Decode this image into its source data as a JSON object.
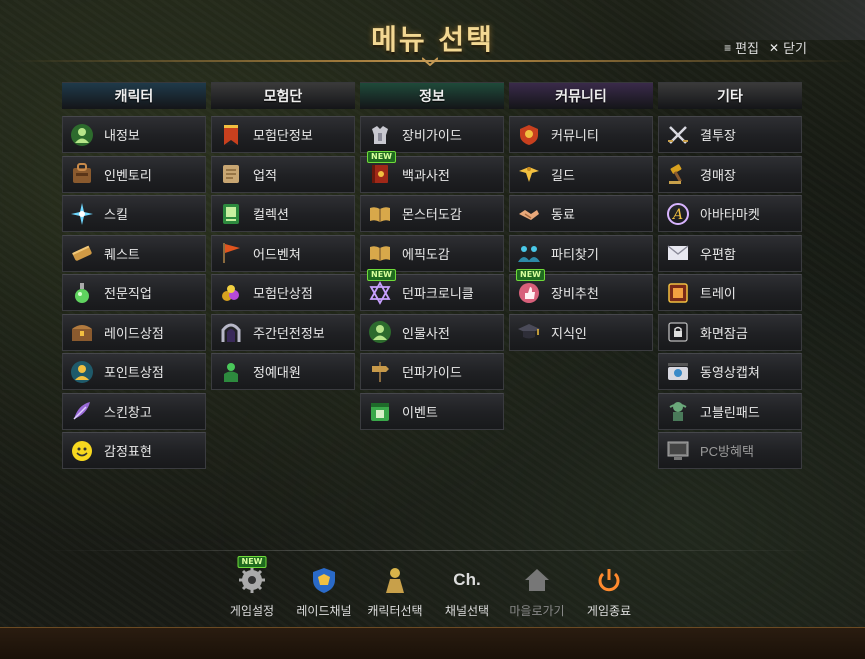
{
  "title": "메뉴 선택",
  "top_actions": {
    "edit_label": "편집",
    "close_label": "닫기"
  },
  "columns": [
    {
      "header": "캐릭터",
      "header_color": "#1f3a4a",
      "items": [
        {
          "label": "내정보",
          "icon": "person-icon"
        },
        {
          "label": "인벤토리",
          "icon": "bag-icon"
        },
        {
          "label": "스킬",
          "icon": "star-burst-icon"
        },
        {
          "label": "퀘스트",
          "icon": "scroll-icon"
        },
        {
          "label": "전문직업",
          "icon": "potion-icon"
        },
        {
          "label": "레이드상점",
          "icon": "chest-icon"
        },
        {
          "label": "포인트상점",
          "icon": "coin-person-icon"
        },
        {
          "label": "스킨창고",
          "icon": "feather-icon"
        },
        {
          "label": "감정표현",
          "icon": "smiley-icon"
        }
      ]
    },
    {
      "header": "모험단",
      "header_color": "#3a3a3a",
      "items": [
        {
          "label": "모험단정보",
          "icon": "banner-icon"
        },
        {
          "label": "업적",
          "icon": "parchment-icon"
        },
        {
          "label": "컬렉션",
          "icon": "card-icon"
        },
        {
          "label": "어드벤쳐",
          "icon": "flag-icon"
        },
        {
          "label": "모험단상점",
          "icon": "treasure-icon"
        },
        {
          "label": "주간던전정보",
          "icon": "portal-icon"
        },
        {
          "label": "정예대원",
          "icon": "soldier-icon"
        }
      ]
    },
    {
      "header": "정보",
      "header_color": "#1f4a3a",
      "items": [
        {
          "label": "장비가이드",
          "icon": "armor-icon"
        },
        {
          "label": "백과사전",
          "icon": "red-book-icon",
          "new": "NEW"
        },
        {
          "label": "몬스터도감",
          "icon": "open-book-icon"
        },
        {
          "label": "에픽도감",
          "icon": "open-book-icon"
        },
        {
          "label": "던파크로니클",
          "icon": "hexagram-icon",
          "new": "NEW"
        },
        {
          "label": "인물사전",
          "icon": "person-icon"
        },
        {
          "label": "던파가이드",
          "icon": "signpost-icon"
        },
        {
          "label": "이벤트",
          "icon": "calendar-icon"
        }
      ]
    },
    {
      "header": "커뮤니티",
      "header_color": "#3a2a4a",
      "items": [
        {
          "label": "커뮤니티",
          "icon": "shield-crest-icon"
        },
        {
          "label": "길드",
          "icon": "eagle-icon"
        },
        {
          "label": "동료",
          "icon": "handshake-icon"
        },
        {
          "label": "파티찾기",
          "icon": "party-icon"
        },
        {
          "label": "장비추천",
          "icon": "thumbs-up-icon",
          "new": "NEW"
        },
        {
          "label": "지식인",
          "icon": "graduation-cap-icon"
        }
      ]
    },
    {
      "header": "기타",
      "header_color": "#3a3a3a",
      "items": [
        {
          "label": "결투장",
          "icon": "crossed-swords-icon"
        },
        {
          "label": "경매장",
          "icon": "gavel-icon"
        },
        {
          "label": "아바타마켓",
          "icon": "avatar-market-icon"
        },
        {
          "label": "우편함",
          "icon": "envelope-icon"
        },
        {
          "label": "트레이",
          "icon": "tray-icon"
        },
        {
          "label": "화면잠금",
          "icon": "lock-icon"
        },
        {
          "label": "동영상캡쳐",
          "icon": "camera-icon"
        },
        {
          "label": "고블린패드",
          "icon": "goblin-icon"
        },
        {
          "label": "PC방혜택",
          "icon": "monitor-icon",
          "dim": true
        }
      ]
    }
  ],
  "bottom": [
    {
      "label": "게임설정",
      "icon": "gear-icon",
      "new": "NEW"
    },
    {
      "label": "레이드채널",
      "icon": "raid-shield-icon"
    },
    {
      "label": "캐릭터선택",
      "icon": "character-select-icon"
    },
    {
      "label": "채널선택",
      "icon": "channel-icon",
      "glyph": "Ch."
    },
    {
      "label": "마을로가기",
      "icon": "home-icon",
      "disabled": true
    },
    {
      "label": "게임종료",
      "icon": "power-icon"
    }
  ]
}
